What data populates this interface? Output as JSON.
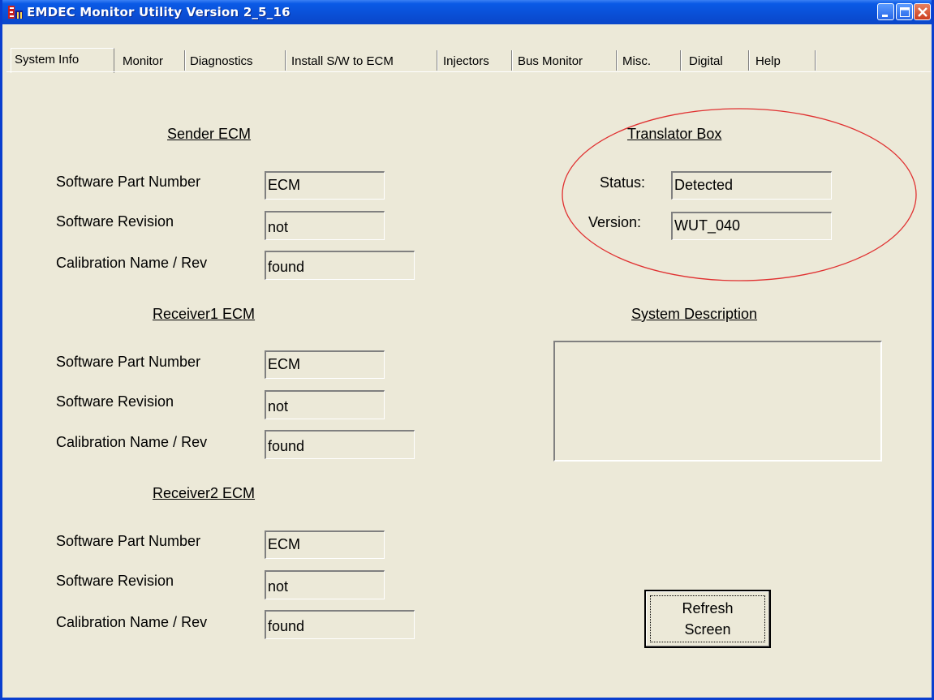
{
  "window": {
    "title": "EMDEC Monitor Utility Version 2_5_16"
  },
  "tabs": [
    {
      "label": "System Info"
    },
    {
      "label": "Monitor"
    },
    {
      "label": "Diagnostics"
    },
    {
      "label": "Install S/W to ECM"
    },
    {
      "label": "Injectors"
    },
    {
      "label": "Bus Monitor"
    },
    {
      "label": "Misc."
    },
    {
      "label": "Digital"
    },
    {
      "label": "Help"
    }
  ],
  "sender": {
    "heading": "Sender ECM",
    "part_label": "Software Part Number",
    "part_value": "ECM",
    "rev_label": "Software Revision",
    "rev_value": "not",
    "cal_label": "Calibration Name / Rev",
    "cal_value": "found"
  },
  "receiver1": {
    "heading": "Receiver1 ECM",
    "part_label": "Software Part Number",
    "part_value": "ECM",
    "rev_label": "Software Revision",
    "rev_value": "not",
    "cal_label": "Calibration Name / Rev",
    "cal_value": "found"
  },
  "receiver2": {
    "heading": "Receiver2 ECM",
    "part_label": "Software Part Number",
    "part_value": "ECM",
    "rev_label": "Software Revision",
    "rev_value": "not",
    "cal_label": "Calibration Name / Rev",
    "cal_value": "found"
  },
  "translator": {
    "heading": "Translator Box",
    "status_label": "Status:",
    "status_value": "Detected",
    "version_label": "Version:",
    "version_value": "WUT_040",
    "highlight_color": "#e03030"
  },
  "system_description": {
    "heading": "System Description",
    "value": ""
  },
  "refresh_button": {
    "line1": "Refresh",
    "line2": "Screen"
  }
}
